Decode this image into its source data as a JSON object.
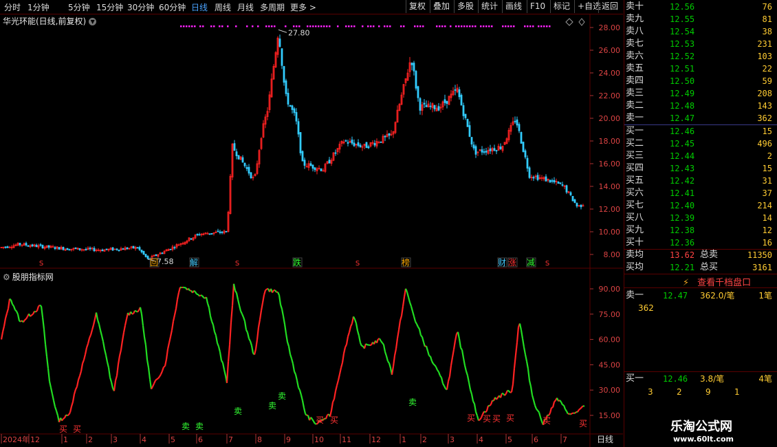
{
  "toolbar": {
    "periods": [
      "分时",
      "1分钟",
      "5分钟",
      "15分钟",
      "30分钟",
      "60分钟",
      "日线",
      "周线",
      "月线",
      "多周期",
      "更多 >"
    ],
    "active_period": "日线",
    "buttons": [
      "复权",
      "叠加",
      "多股",
      "统计",
      "画线",
      "F10",
      "标记",
      "+自选",
      "返回"
    ]
  },
  "stock": {
    "title": "华光环能(日线,前复权)"
  },
  "indicator": {
    "title": "股朋指标网",
    "gear_icon": "gear-icon"
  },
  "price_axis": [
    "28.00",
    "26.00",
    "24.00",
    "22.00",
    "20.00",
    "18.00",
    "16.00",
    "14.00",
    "12.00",
    "10.00",
    "8.00"
  ],
  "ind_axis": [
    "90.00",
    "75.00",
    "60.00",
    "45.00",
    "30.00",
    "15.00"
  ],
  "annotations": {
    "high": "27.80",
    "low": "7.58"
  },
  "date_axis": [
    "2024年",
    "12",
    "1",
    "2",
    "3",
    "4",
    "5",
    "6",
    "7",
    "8",
    "9",
    "10",
    "11",
    "12",
    "1",
    "2",
    "3",
    "4",
    "5",
    "6",
    "7"
  ],
  "period_label": "日线",
  "event_markers": [
    "S",
    "回",
    "解",
    "S",
    "跌",
    "S",
    "榜",
    "财",
    "涨",
    "减",
    "S"
  ],
  "buy_sell_labels": {
    "buy": "买",
    "sell": "卖"
  },
  "order_book": {
    "asks": [
      {
        "label": "卖十",
        "price": "12.56",
        "vol": "76"
      },
      {
        "label": "卖九",
        "price": "12.55",
        "vol": "81"
      },
      {
        "label": "卖八",
        "price": "12.54",
        "vol": "38"
      },
      {
        "label": "卖七",
        "price": "12.53",
        "vol": "231"
      },
      {
        "label": "卖六",
        "price": "12.52",
        "vol": "103"
      },
      {
        "label": "卖五",
        "price": "12.51",
        "vol": "22"
      },
      {
        "label": "卖四",
        "price": "12.50",
        "vol": "59"
      },
      {
        "label": "卖三",
        "price": "12.49",
        "vol": "208"
      },
      {
        "label": "卖二",
        "price": "12.48",
        "vol": "143"
      },
      {
        "label": "卖一",
        "price": "12.47",
        "vol": "362"
      }
    ],
    "bids": [
      {
        "label": "买一",
        "price": "12.46",
        "vol": "15"
      },
      {
        "label": "买二",
        "price": "12.45",
        "vol": "496"
      },
      {
        "label": "买三",
        "price": "12.44",
        "vol": "2"
      },
      {
        "label": "买四",
        "price": "12.43",
        "vol": "15"
      },
      {
        "label": "买五",
        "price": "12.42",
        "vol": "31"
      },
      {
        "label": "买六",
        "price": "12.41",
        "vol": "37"
      },
      {
        "label": "买七",
        "price": "12.40",
        "vol": "214"
      },
      {
        "label": "买八",
        "price": "12.39",
        "vol": "14"
      },
      {
        "label": "买九",
        "price": "12.38",
        "vol": "12"
      },
      {
        "label": "买十",
        "price": "12.36",
        "vol": "16"
      }
    ],
    "avg_ask": {
      "label": "卖均",
      "price": "13.62",
      "total_label": "总卖",
      "total": "11350"
    },
    "avg_bid": {
      "label": "买均",
      "price": "12.21",
      "total_label": "总买",
      "total": "3161"
    },
    "depth_button": "查看千档盘口",
    "ask1_detail": {
      "label": "卖一",
      "price": "12.47",
      "size": "362.0/笔",
      "count": "1笔",
      "orders": [
        "362"
      ]
    },
    "bid1_detail": {
      "label": "买一",
      "price": "12.46",
      "size": "3.8/笔",
      "count": "4笔",
      "orders": [
        "3",
        "2",
        "9",
        "1"
      ]
    }
  },
  "watermark": {
    "line1": "乐淘公式网",
    "line2": "www.60lt.com"
  },
  "chart_data": {
    "type": "candlestick",
    "title": "华光环能(日线,前复权)",
    "price_range": [
      7.5,
      28.5
    ],
    "key_points": [
      {
        "t": 0,
        "v": 8.6
      },
      {
        "t": 30,
        "v": 8.9
      },
      {
        "t": 60,
        "v": 8.7
      },
      {
        "t": 100,
        "v": 8.5
      },
      {
        "t": 150,
        "v": 8.4
      },
      {
        "t": 200,
        "v": 8.6
      },
      {
        "t": 215,
        "v": 7.58
      },
      {
        "t": 250,
        "v": 8.6
      },
      {
        "t": 290,
        "v": 9.8
      },
      {
        "t": 330,
        "v": 10.0
      },
      {
        "t": 338,
        "v": 17.5
      },
      {
        "t": 370,
        "v": 14.5
      },
      {
        "t": 380,
        "v": 18.5
      },
      {
        "t": 390,
        "v": 21.0
      },
      {
        "t": 405,
        "v": 27.8
      },
      {
        "t": 415,
        "v": 22.0
      },
      {
        "t": 430,
        "v": 20.0
      },
      {
        "t": 440,
        "v": 16.0
      },
      {
        "t": 470,
        "v": 15.5
      },
      {
        "t": 500,
        "v": 18.0
      },
      {
        "t": 530,
        "v": 17.5
      },
      {
        "t": 570,
        "v": 18.5
      },
      {
        "t": 598,
        "v": 25.4
      },
      {
        "t": 610,
        "v": 21.0
      },
      {
        "t": 640,
        "v": 21.0
      },
      {
        "t": 665,
        "v": 22.5
      },
      {
        "t": 690,
        "v": 17.0
      },
      {
        "t": 730,
        "v": 17.5
      },
      {
        "t": 750,
        "v": 20.0
      },
      {
        "t": 770,
        "v": 15.0
      },
      {
        "t": 800,
        "v": 14.5
      },
      {
        "t": 820,
        "v": 14.0
      },
      {
        "t": 840,
        "v": 12.2
      },
      {
        "t": 850,
        "v": 12.5
      }
    ],
    "indicator": {
      "name": "股朋指标网",
      "range": [
        0,
        100
      ],
      "key_points": [
        {
          "t": 2,
          "v": 60
        },
        {
          "t": 15,
          "v": 85
        },
        {
          "t": 30,
          "v": 70
        },
        {
          "t": 45,
          "v": 75
        },
        {
          "t": 60,
          "v": 80
        },
        {
          "t": 72,
          "v": 35
        },
        {
          "t": 85,
          "v": 12
        },
        {
          "t": 100,
          "v": 15
        },
        {
          "t": 140,
          "v": 75
        },
        {
          "t": 152,
          "v": 55
        },
        {
          "t": 165,
          "v": 28
        },
        {
          "t": 185,
          "v": 75
        },
        {
          "t": 205,
          "v": 78
        },
        {
          "t": 220,
          "v": 30
        },
        {
          "t": 240,
          "v": 45
        },
        {
          "t": 262,
          "v": 92
        },
        {
          "t": 300,
          "v": 85
        },
        {
          "t": 330,
          "v": 35
        },
        {
          "t": 340,
          "v": 92
        },
        {
          "t": 370,
          "v": 50
        },
        {
          "t": 385,
          "v": 90
        },
        {
          "t": 405,
          "v": 88
        },
        {
          "t": 420,
          "v": 55
        },
        {
          "t": 445,
          "v": 15
        },
        {
          "t": 460,
          "v": 10
        },
        {
          "t": 480,
          "v": 15
        },
        {
          "t": 505,
          "v": 60
        },
        {
          "t": 515,
          "v": 75
        },
        {
          "t": 525,
          "v": 55
        },
        {
          "t": 555,
          "v": 60
        },
        {
          "t": 570,
          "v": 40
        },
        {
          "t": 590,
          "v": 90
        },
        {
          "t": 605,
          "v": 70
        },
        {
          "t": 625,
          "v": 50
        },
        {
          "t": 650,
          "v": 30
        },
        {
          "t": 665,
          "v": 65
        },
        {
          "t": 695,
          "v": 12
        },
        {
          "t": 720,
          "v": 25
        },
        {
          "t": 745,
          "v": 30
        },
        {
          "t": 755,
          "v": 72
        },
        {
          "t": 775,
          "v": 25
        },
        {
          "t": 790,
          "v": 10
        },
        {
          "t": 810,
          "v": 25
        },
        {
          "t": 830,
          "v": 15
        },
        {
          "t": 850,
          "v": 20
        }
      ]
    }
  },
  "colors": {
    "up": "#ff2222",
    "down": "#22dd22",
    "down_price": "#33ccff",
    "grid": "#5a0000",
    "axis_text": "#dd4444",
    "magenta": "#ff22ff"
  }
}
